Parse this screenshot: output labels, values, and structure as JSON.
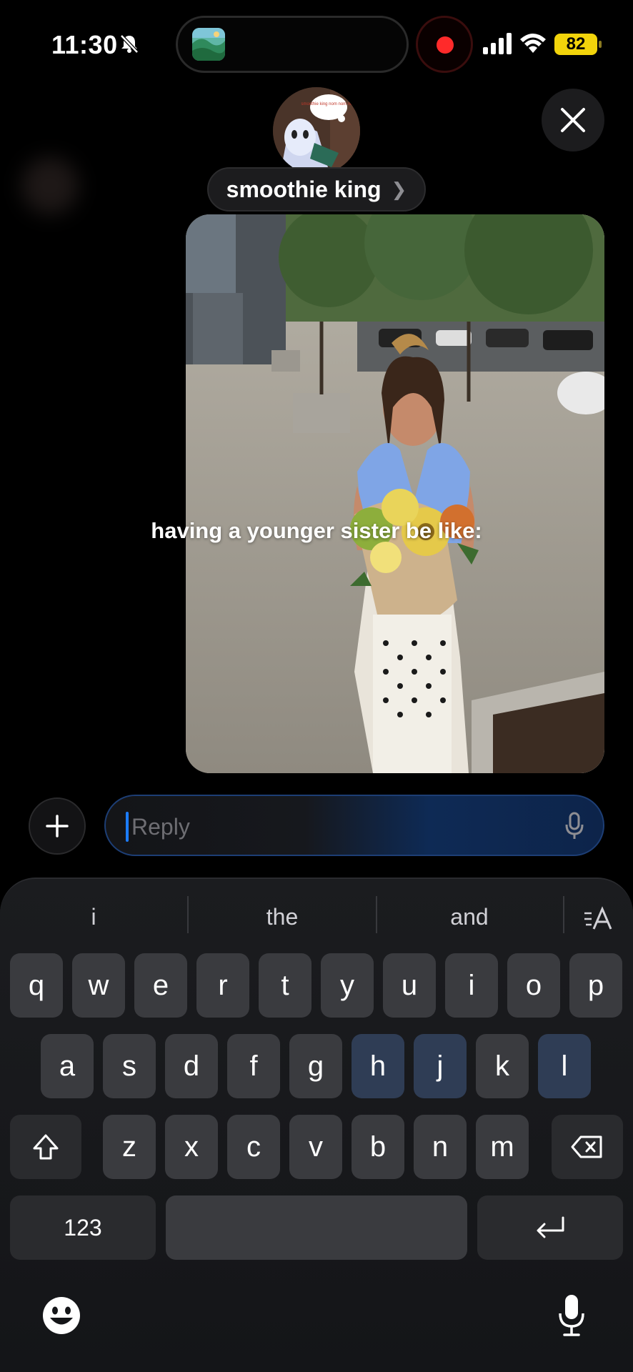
{
  "status_bar": {
    "time": "11:30",
    "battery": "82",
    "app_thumbnail_icon": "landscape-app-icon",
    "recording_indicator_color": "#ff2a2a",
    "battery_color": "#f2d40b"
  },
  "header": {
    "contact_name": "smoothie king",
    "avatar_caption": "smoothie king nom nom nom"
  },
  "story": {
    "caption": "having a younger sister be like:"
  },
  "reply": {
    "placeholder": "Reply",
    "accent_color": "#1c7cff"
  },
  "keyboard": {
    "suggestions": [
      "i",
      "the",
      "and"
    ],
    "row1": [
      "q",
      "w",
      "e",
      "r",
      "t",
      "y",
      "u",
      "i",
      "o",
      "p"
    ],
    "row2": [
      "a",
      "s",
      "d",
      "f",
      "g",
      "h",
      "j",
      "k",
      "l"
    ],
    "row3": [
      "z",
      "x",
      "c",
      "v",
      "b",
      "n",
      "m"
    ],
    "numbers_label": "123",
    "icons": {
      "shift": "shift-icon",
      "delete": "delete-icon",
      "return": "return-icon",
      "emoji": "emoji-icon",
      "dictation": "microphone-icon",
      "text_format": "text-format-icon"
    }
  }
}
